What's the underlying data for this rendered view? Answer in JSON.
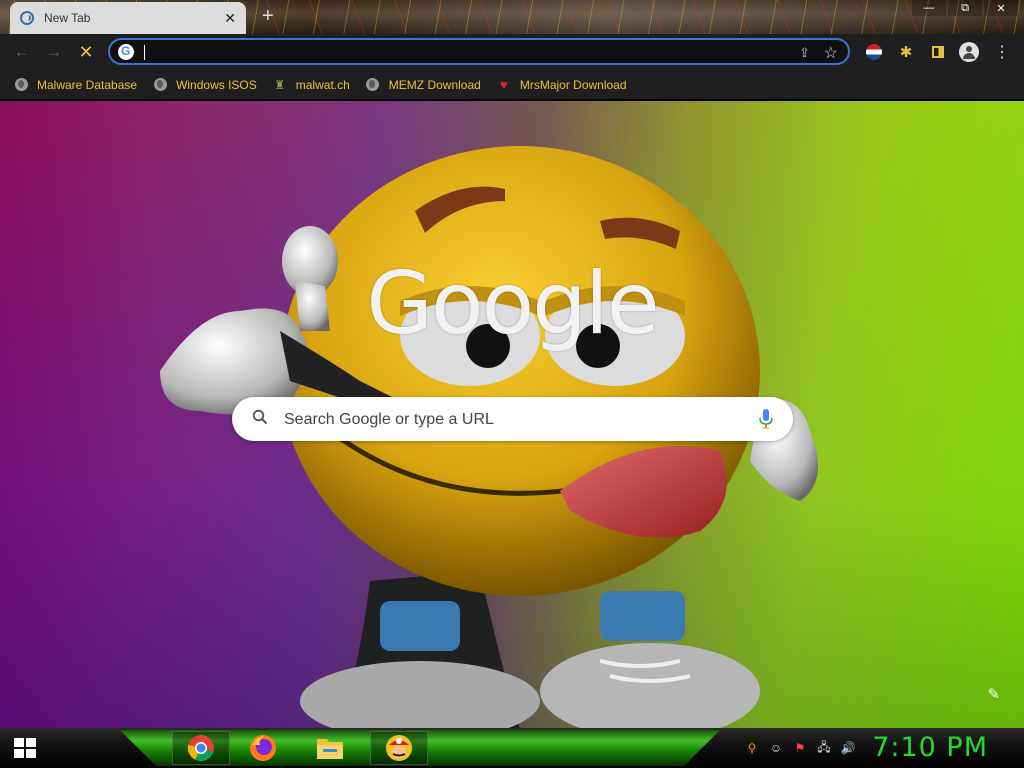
{
  "window": {
    "minimize_glyph": "—",
    "maximize_glyph": "⧉",
    "close_glyph": "✕"
  },
  "tab": {
    "title": "New Tab",
    "close_glyph": "✕",
    "new_tab_glyph": "+"
  },
  "toolbar": {
    "back_glyph": "←",
    "forward_glyph": "→",
    "stop_glyph": "✕",
    "omnibox_value": "",
    "share_glyph": "⇪",
    "star_glyph": "☆",
    "extensions_glyph": "✱",
    "menu_glyph": "⋮"
  },
  "bookmarks": [
    {
      "label": "Malware Database",
      "icon": "globe-icon"
    },
    {
      "label": "Windows ISOS",
      "icon": "globe-icon"
    },
    {
      "label": "malwat.ch",
      "icon": "bug-icon"
    },
    {
      "label": "MEMZ Download",
      "icon": "globe-icon"
    },
    {
      "label": "MrsMajor Download",
      "icon": "heart-icon"
    }
  ],
  "bookmark_glyphs": {
    "bug": "♜",
    "heart": "♥"
  },
  "ntp": {
    "logo": "Google",
    "search_placeholder": "Search Google or type a URL",
    "edit_glyph": "✎"
  },
  "taskbar": {
    "apps": [
      "chrome-icon",
      "firefox-icon",
      "file-explorer-icon",
      "mario-icon"
    ],
    "tray_icons": [
      "search-icon",
      "chat-icon",
      "action-center-flag-icon",
      "network-icon",
      "volume-icon"
    ],
    "tray_glyphs": [
      "⚲",
      "☺",
      "⚑",
      "🖧",
      "🔊"
    ],
    "clock": "7:10 PM"
  },
  "colors": {
    "accent_yellow": "#e8c040",
    "omnibox_border": "#3b74d8",
    "clock_green": "#22dd22",
    "taskbar_green": "#49d12c"
  }
}
